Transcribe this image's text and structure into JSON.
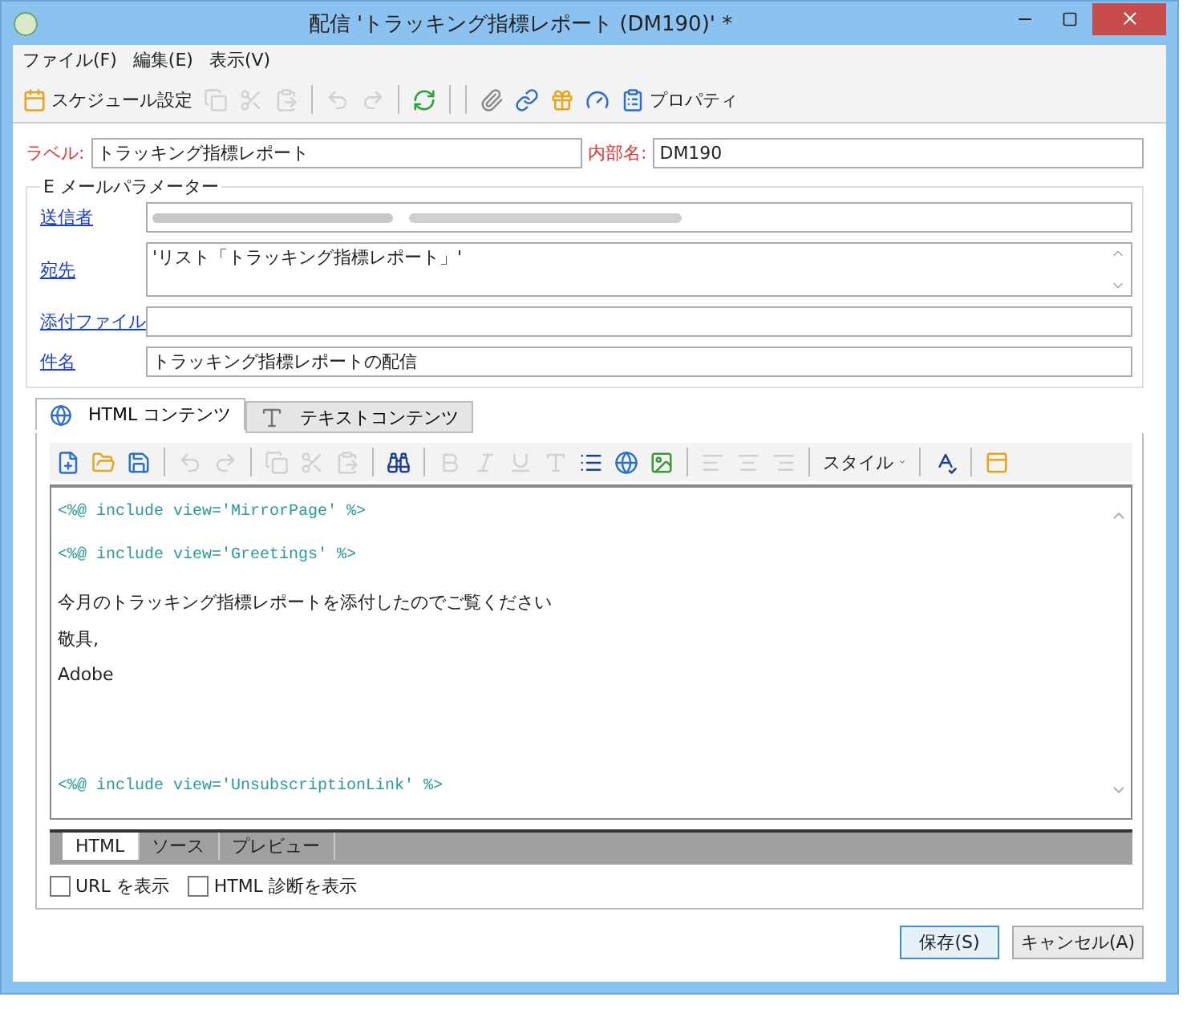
{
  "window": {
    "title": "配信 'トラッキング指標レポート (DM190)' *"
  },
  "menu": [
    "ファイル(F)",
    "編集(E)",
    "表示(V)"
  ],
  "toolbar": [
    {
      "kind": "button",
      "label": "スケジュール設定",
      "disabled": false
    },
    {
      "kind": "icon",
      "disabled": true
    },
    {
      "kind": "icon",
      "disabled": true
    },
    {
      "kind": "icon",
      "disabled": true
    },
    {
      "kind": "separator"
    },
    {
      "kind": "icon",
      "disabled": true
    },
    {
      "kind": "icon",
      "disabled": true
    },
    {
      "kind": "separator"
    },
    {
      "kind": "icon",
      "disabled": false
    },
    {
      "kind": "separator"
    },
    {
      "kind": "separator"
    },
    {
      "kind": "icon",
      "disabled": false
    },
    {
      "kind": "icon",
      "disabled": false
    },
    {
      "kind": "icon",
      "disabled": false
    },
    {
      "kind": "icon",
      "disabled": false
    },
    {
      "kind": "button",
      "label": "プロパティ",
      "disabled": false
    }
  ],
  "label_field": {
    "label": "ラベル:",
    "value": "トラッキング指標レポート"
  },
  "internal_name": {
    "label": "内部名:",
    "value": "DM190"
  },
  "email_params": {
    "title": "E メールパラメーター",
    "fields": [
      {
        "label": "送信者",
        "kind": "redacted"
      },
      {
        "label": "宛先",
        "kind": "textarea",
        "value": "'リスト「トラッキング指標レポート」'"
      },
      {
        "label": "添付ファイル",
        "kind": "input"
      },
      {
        "label": "件名",
        "kind": "input",
        "value": "トラッキング指標レポートの配信"
      }
    ]
  },
  "content_tabs": [
    {
      "label": "HTML コンテンツ",
      "selected": true
    },
    {
      "label": "テキストコンテンツ",
      "selected": false
    }
  ],
  "editor_toolbar": [
    {
      "kind": "icon",
      "disabled": false
    },
    {
      "kind": "icon",
      "disabled": false
    },
    {
      "kind": "icon",
      "disabled": false
    },
    {
      "kind": "separator"
    },
    {
      "kind": "icon",
      "disabled": true
    },
    {
      "kind": "icon",
      "disabled": true
    },
    {
      "kind": "separator"
    },
    {
      "kind": "icon",
      "disabled": true
    },
    {
      "kind": "icon",
      "disabled": true
    },
    {
      "kind": "icon",
      "disabled": true
    },
    {
      "kind": "separator"
    },
    {
      "kind": "icon",
      "disabled": false
    },
    {
      "kind": "separator"
    },
    {
      "kind": "icon",
      "disabled": true
    },
    {
      "kind": "icon",
      "disabled": true
    },
    {
      "kind": "icon",
      "disabled": true
    },
    {
      "kind": "icon",
      "disabled": true
    },
    {
      "kind": "icon",
      "disabled": false
    },
    {
      "kind": "icon",
      "disabled": false
    },
    {
      "kind": "icon",
      "disabled": false
    },
    {
      "kind": "separator"
    },
    {
      "kind": "icon",
      "disabled": true
    },
    {
      "kind": "icon",
      "disabled": true
    },
    {
      "kind": "icon",
      "disabled": true
    },
    {
      "kind": "separator"
    },
    {
      "kind": "dropdown",
      "label": "スタイル"
    },
    {
      "kind": "separator"
    },
    {
      "kind": "icon",
      "disabled": false
    },
    {
      "kind": "separator"
    },
    {
      "kind": "icon",
      "disabled": false
    }
  ],
  "editor_lines": [
    {
      "kind": "code",
      "text": "<%@ include view='MirrorPage' %>"
    },
    {
      "kind": "code",
      "text": "<%@ include view='Greetings' %>"
    },
    {
      "kind": "text",
      "text": "今月のトラッキング指標レポートを添付したのでご覧ください"
    },
    {
      "kind": "text",
      "text": "敬具,"
    },
    {
      "kind": "text",
      "text": "Adobe"
    },
    {
      "kind": "code",
      "text": "<%@ include view='UnsubscriptionLink' %>"
    }
  ],
  "view_tabs": [
    {
      "label": "HTML",
      "selected": true
    },
    {
      "label": "ソース",
      "selected": false
    },
    {
      "label": "プレビュー",
      "selected": false
    }
  ],
  "options": [
    {
      "label": "URL を表示",
      "checked": false
    },
    {
      "label": "HTML 診断を表示",
      "checked": false
    }
  ],
  "buttons": [
    {
      "label": "保存(S)",
      "default": true
    },
    {
      "label": "キャンセル(A)",
      "default": false
    }
  ]
}
